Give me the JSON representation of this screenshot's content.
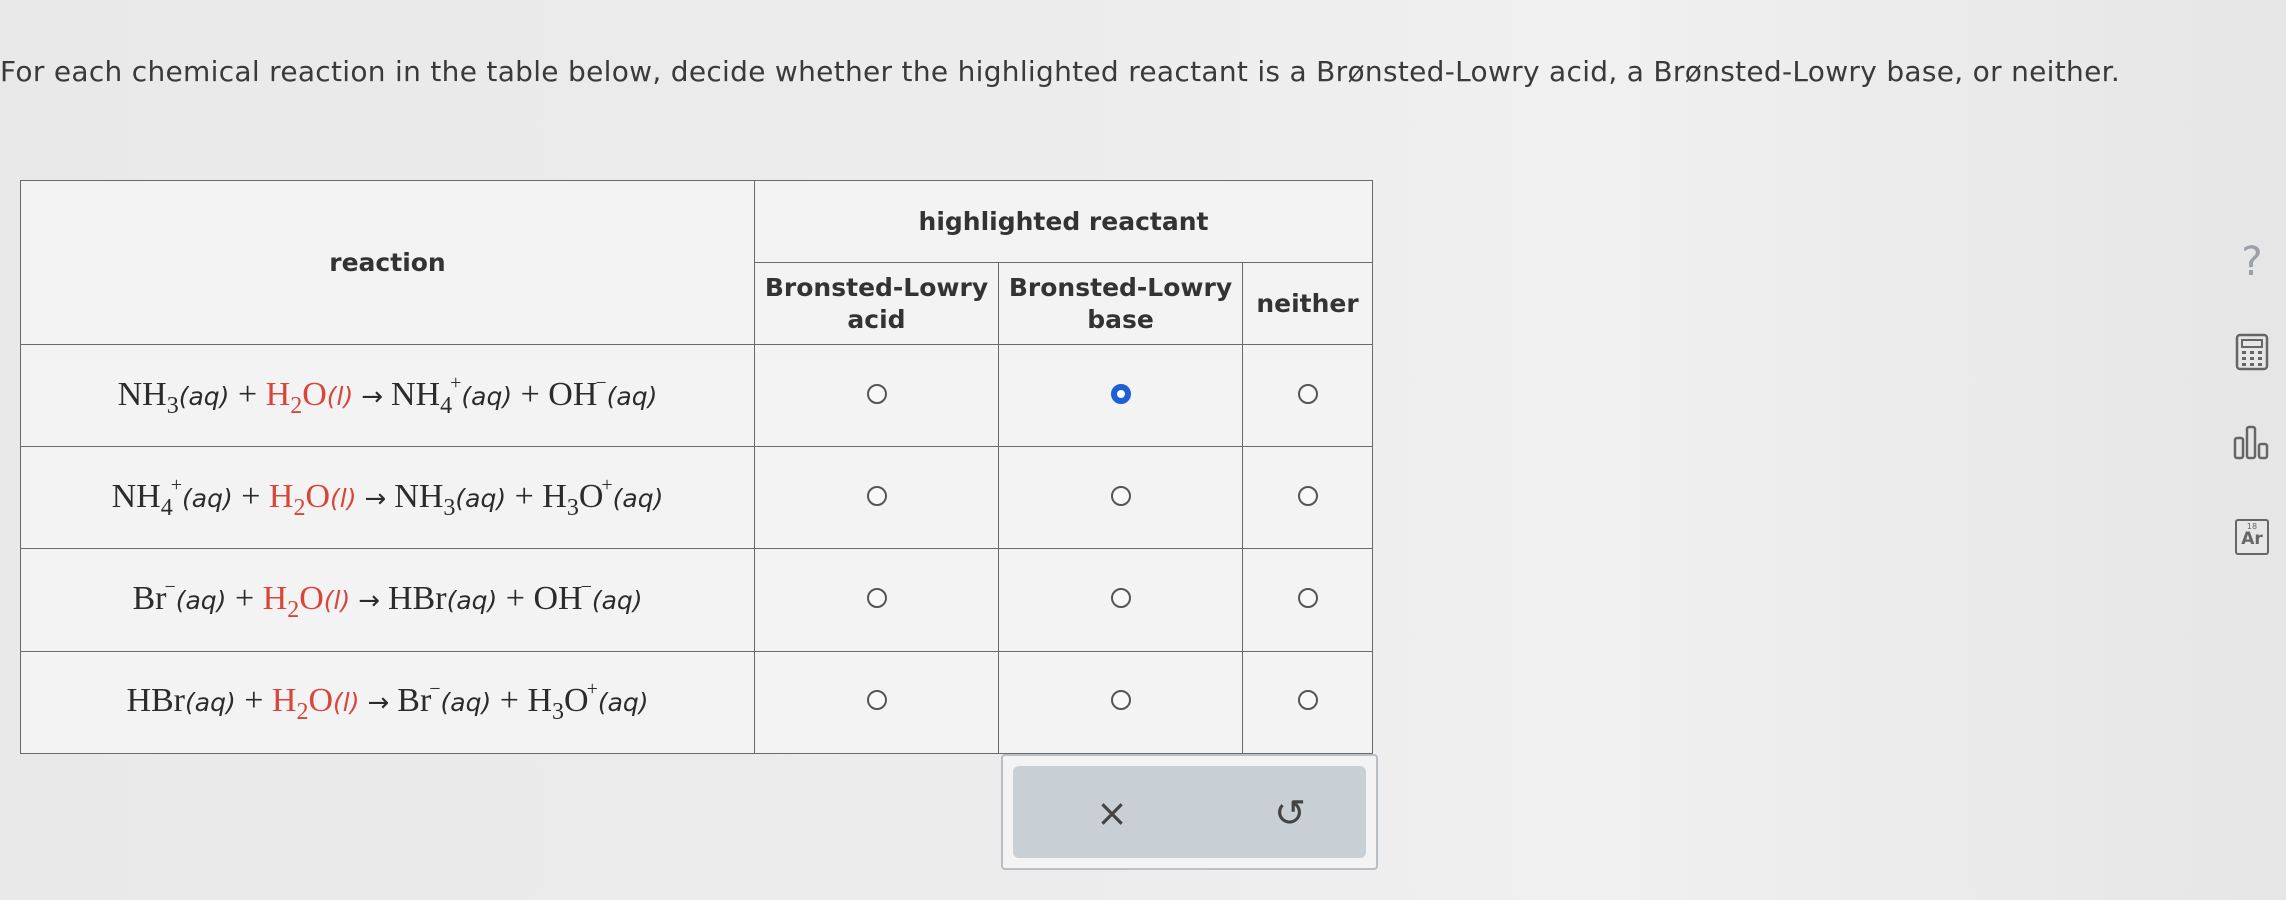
{
  "instruction": "For each chemical reaction in the table below, decide whether the highlighted reactant is a Brønsted-Lowry acid, a Brønsted-Lowry base, or neither.",
  "table": {
    "reaction_header": "reaction",
    "group_header": "highlighted reactant",
    "col_acid_line1": "Bronsted-Lowry",
    "col_acid_line2": "acid",
    "col_base_line1": "Bronsted-Lowry",
    "col_base_line2": "base",
    "col_neither": "neither",
    "rows": [
      {
        "reaction": "NH3(aq) + H2O(l) → NH4+(aq) + OH−(aq)",
        "selected": "base"
      },
      {
        "reaction": "NH4+(aq) + H2O(l) → NH3(aq) + H3O+(aq)",
        "selected": null
      },
      {
        "reaction": "Br−(aq) + H2O(l) → HBr(aq) + OH−(aq)",
        "selected": null
      },
      {
        "reaction": "HBr(aq) + H2O(l) → Br−(aq) + H3O+(aq)",
        "selected": null
      }
    ]
  },
  "eq": {
    "aq": "(aq)",
    "l": "(l)",
    "plus": " + ",
    "arrow": "→",
    "nh": "NH",
    "h": "H",
    "o": "O",
    "oh": "OH",
    "br": "Br",
    "hbr": "HBr",
    "n2": "2",
    "n3": "3",
    "n4": "4",
    "pos": "+",
    "neg": "−"
  },
  "actions": {
    "clear_symbol": "×",
    "undo_symbol": "↺"
  },
  "sidebar": {
    "help_symbol": "?",
    "element_number": "18",
    "element_symbol": "Ar"
  },
  "colors": {
    "highlight": "#d8453a",
    "selected_radio": "#1f5fd6"
  }
}
